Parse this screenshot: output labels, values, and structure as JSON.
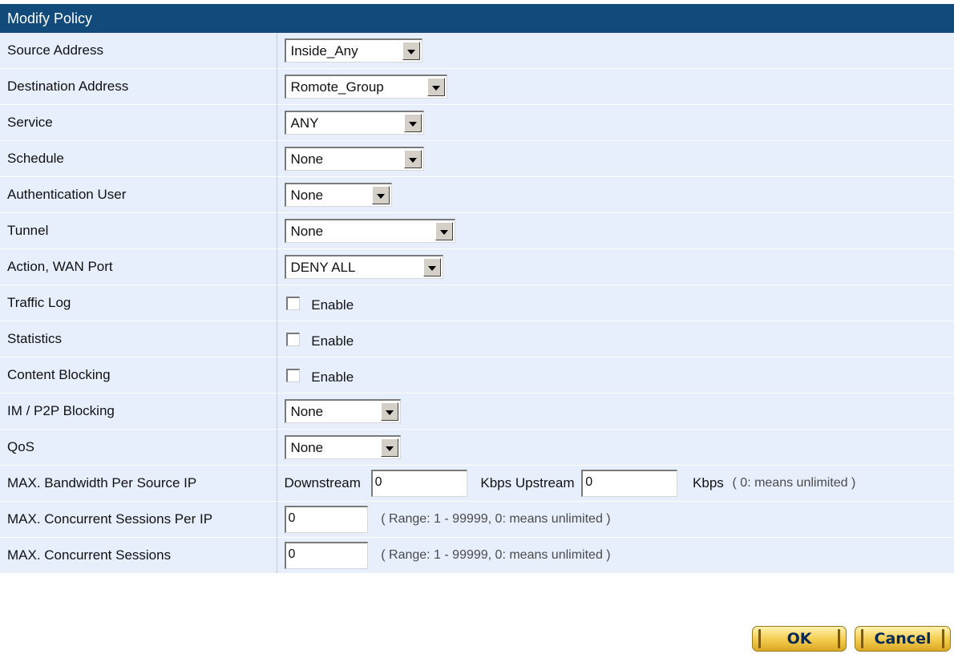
{
  "title": "Modify Policy",
  "rows": {
    "source_address": {
      "label": "Source Address",
      "value": "Inside_Any"
    },
    "destination_address": {
      "label": "Destination Address",
      "value": "Romote_Group"
    },
    "service": {
      "label": "Service",
      "value": "ANY"
    },
    "schedule": {
      "label": "Schedule",
      "value": "None"
    },
    "auth_user": {
      "label": "Authentication User",
      "value": "None"
    },
    "tunnel": {
      "label": "Tunnel",
      "value": "None"
    },
    "action_wan": {
      "label": "Action, WAN Port",
      "value": "DENY ALL"
    },
    "traffic_log": {
      "label": "Traffic Log",
      "checkbox_label": "Enable",
      "checked": false
    },
    "statistics": {
      "label": "Statistics",
      "checkbox_label": "Enable",
      "checked": false
    },
    "content_blocking": {
      "label": "Content Blocking",
      "checkbox_label": "Enable",
      "checked": false
    },
    "im_p2p": {
      "label": "IM / P2P Blocking",
      "value": "None"
    },
    "qos": {
      "label": "QoS",
      "value": "None"
    },
    "max_bandwidth": {
      "label": "MAX. Bandwidth Per Source IP",
      "downstream_label": "Downstream",
      "downstream_value": "0",
      "upstream_label": "Kbps Upstream",
      "upstream_value": "0",
      "unit_label": "Kbps",
      "hint": "( 0: means unlimited )"
    },
    "max_sessions_per_ip": {
      "label": "MAX. Concurrent Sessions Per IP",
      "value": "0",
      "hint": "( Range: 1 - 99999, 0: means unlimited )"
    },
    "max_sessions": {
      "label": "MAX. Concurrent Sessions",
      "value": "0",
      "hint": "( Range: 1 - 99999, 0: means unlimited )"
    }
  },
  "buttons": {
    "ok": "OK",
    "cancel": "Cancel"
  },
  "colors": {
    "title_bar": "#124a7c",
    "row_background": "#e8effc",
    "button": "#f3cb4c"
  }
}
